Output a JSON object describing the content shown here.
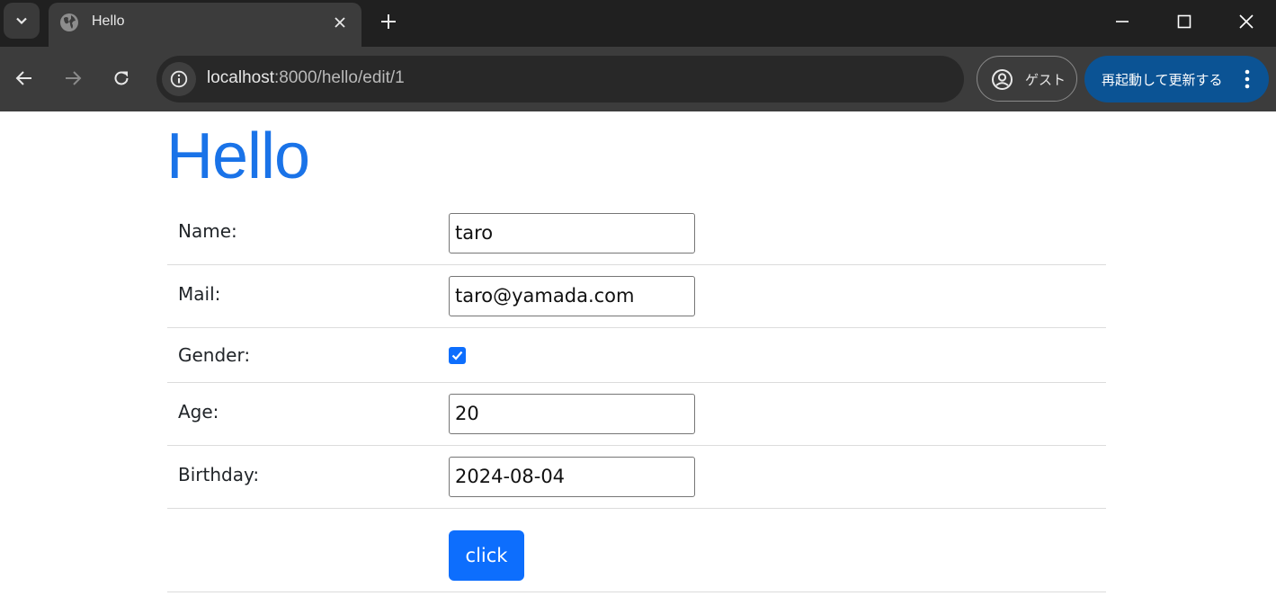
{
  "browser": {
    "tab_title": "Hello",
    "url_host": "localhost",
    "url_rest": ":8000/hello/edit/1",
    "profile_label": "ゲスト",
    "update_label": "再起動して更新する"
  },
  "page": {
    "title": "Hello",
    "fields": [
      {
        "label": "Name:",
        "value": "taro"
      },
      {
        "label": "Mail:",
        "value": "taro@yamada.com"
      },
      {
        "label": "Gender:",
        "checked": true
      },
      {
        "label": "Age:",
        "value": "20"
      },
      {
        "label": "Birthday:",
        "value": "2024-08-04"
      }
    ],
    "submit_label": "click"
  },
  "colors": {
    "title": "#1a73e8",
    "primary": "#0d6efd",
    "update_button": "#0b5394"
  }
}
